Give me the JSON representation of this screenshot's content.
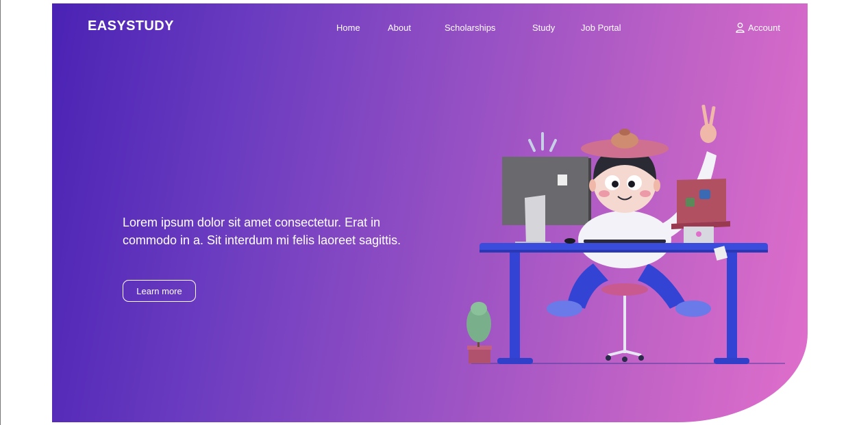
{
  "brand": {
    "name": "EASYSTUDY"
  },
  "nav": {
    "items": [
      {
        "label": "Home"
      },
      {
        "label": "About"
      },
      {
        "label": "Scholarships"
      },
      {
        "label": "Study"
      },
      {
        "label": "Job Portal"
      }
    ],
    "account_label": "Account"
  },
  "hero": {
    "text": "Lorem ipsum dolor sit amet consectetur. Erat in commodo in a. Sit interdum mi felis laoreet sagittis.",
    "cta_label": "Learn more"
  },
  "icons": {
    "account": "user-icon"
  },
  "colors": {
    "gradient_start": "#4a22b4",
    "gradient_end": "#e06ecb",
    "text": "#ffffff"
  }
}
